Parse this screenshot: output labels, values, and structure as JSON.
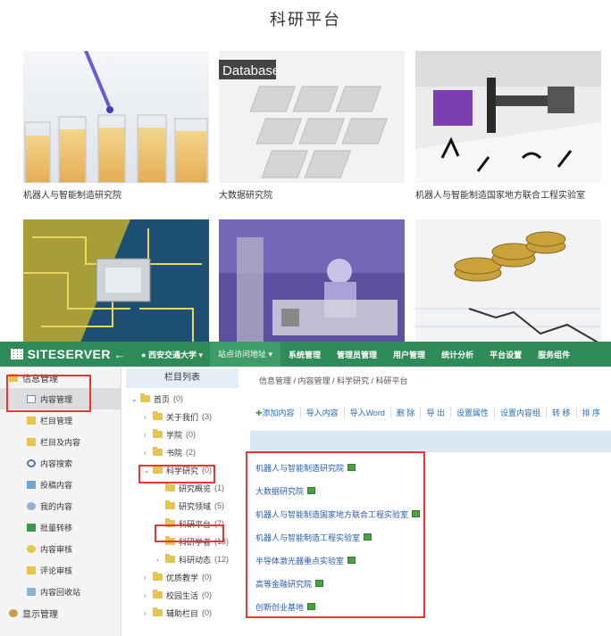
{
  "platform": {
    "title": "科研平台",
    "cards": [
      {
        "caption": "机器人与智能制造研究院"
      },
      {
        "caption": "大数据研究院",
        "photo_text": "Database"
      },
      {
        "caption": "机器人与智能制造国家地方联合工程实验室"
      },
      {
        "caption": ""
      },
      {
        "caption": ""
      },
      {
        "caption": ""
      }
    ]
  },
  "cms": {
    "logo": "SITESERVER",
    "back_icon": "arrow-left-icon",
    "site_select": "西安交通大学 ▾",
    "nav": [
      "站点访问地址 ▾",
      "系统管理",
      "管理员管理",
      "用户管理",
      "统计分析",
      "平台设置",
      "服务组件"
    ],
    "left_menu": [
      {
        "label": "信息管理",
        "top": true
      },
      {
        "label": "内容管理",
        "selected": true
      },
      {
        "label": "栏目管理"
      },
      {
        "label": "栏目及内容"
      },
      {
        "label": "内容搜索"
      },
      {
        "label": "投稿内容"
      },
      {
        "label": "我的内容"
      },
      {
        "label": "批量转移"
      },
      {
        "label": "内容审核"
      },
      {
        "label": "评论审核"
      },
      {
        "label": "内容回收站"
      },
      {
        "label": "显示管理",
        "top": true
      }
    ],
    "tree_header": "栏目列表",
    "tree": [
      {
        "label": "首页",
        "count": "(0)",
        "level": 0,
        "arrow": "⌄"
      },
      {
        "label": "关于我们",
        "count": "(3)",
        "level": 1,
        "arrow": "›"
      },
      {
        "label": "学院",
        "count": "(0)",
        "level": 1,
        "arrow": "›"
      },
      {
        "label": "书院",
        "count": "(2)",
        "level": 1,
        "arrow": "›"
      },
      {
        "label": "科学研究",
        "count": "(0)",
        "level": 1,
        "arrow": "⌄"
      },
      {
        "label": "研究概览",
        "count": "(1)",
        "level": 2,
        "arrow": ""
      },
      {
        "label": "研究领域",
        "count": "(5)",
        "level": 2,
        "arrow": ""
      },
      {
        "label": "科研平台",
        "count": "(7)",
        "level": 2,
        "arrow": ""
      },
      {
        "label": "科研学者",
        "count": "(13)",
        "level": 2,
        "arrow": ""
      },
      {
        "label": "科研动态",
        "count": "(12)",
        "level": 2,
        "arrow": "›"
      },
      {
        "label": "优质教学",
        "count": "(0)",
        "level": 1,
        "arrow": "›"
      },
      {
        "label": "校园生活",
        "count": "(0)",
        "level": 1,
        "arrow": "›"
      },
      {
        "label": "辅助栏目",
        "count": "(0)",
        "level": 1,
        "arrow": "›"
      }
    ],
    "breadcrumb": "信息管理 / 内容管理 / 科学研究 / 科研平台",
    "toolbar": [
      "添加内容",
      "导入内容",
      "导入Word",
      "删 除",
      "导 出",
      "设置属性",
      "设置内容组",
      "转 移",
      "排 序"
    ],
    "content_items": [
      "机器人与智能制造研究院",
      "大数据研究院",
      "机器人与智能制造国家地方联合工程实验室",
      "机器人与智能制造工程实验室",
      "半导体激光器重点实验室",
      "高等金融研究院",
      "创新创业基地"
    ],
    "colors": {
      "nav": "#2e8b57",
      "highlight": "#e33333",
      "link": "#2a5caa"
    }
  }
}
